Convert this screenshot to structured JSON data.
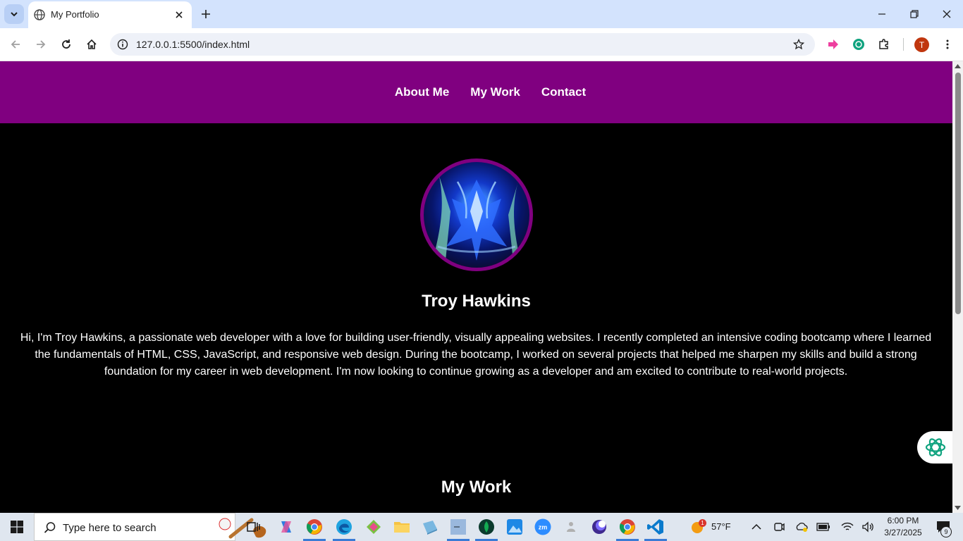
{
  "browser": {
    "tab_title": "My Portfolio",
    "url": "127.0.0.1:5500/index.html",
    "profile_initial": "T"
  },
  "page": {
    "nav": [
      {
        "label": "About Me"
      },
      {
        "label": "My Work"
      },
      {
        "label": "Contact"
      }
    ],
    "name": "Troy Hawkins",
    "bio": "Hi, I'm Troy Hawkins, a passionate web developer with a love for building user-friendly, visually appealing websites. I recently completed an intensive coding bootcamp where I learned the fundamentals of HTML, CSS, JavaScript, and responsive web design. During the bootcamp, I worked on several projects that helped me sharpen my skills and build a strong foundation for my career in web development. I'm now looking to continue growing as a developer and am excited to contribute to real-world projects.",
    "work_heading": "My Work",
    "colors": {
      "nav_bg": "#800080",
      "page_bg": "#000000",
      "text": "#ffffff"
    }
  },
  "taskbar": {
    "search_placeholder": "Type here to search",
    "weather_temp": "57°F",
    "weather_badge": "1",
    "time": "6:00 PM",
    "date": "3/27/2025",
    "notification_count": "9"
  }
}
